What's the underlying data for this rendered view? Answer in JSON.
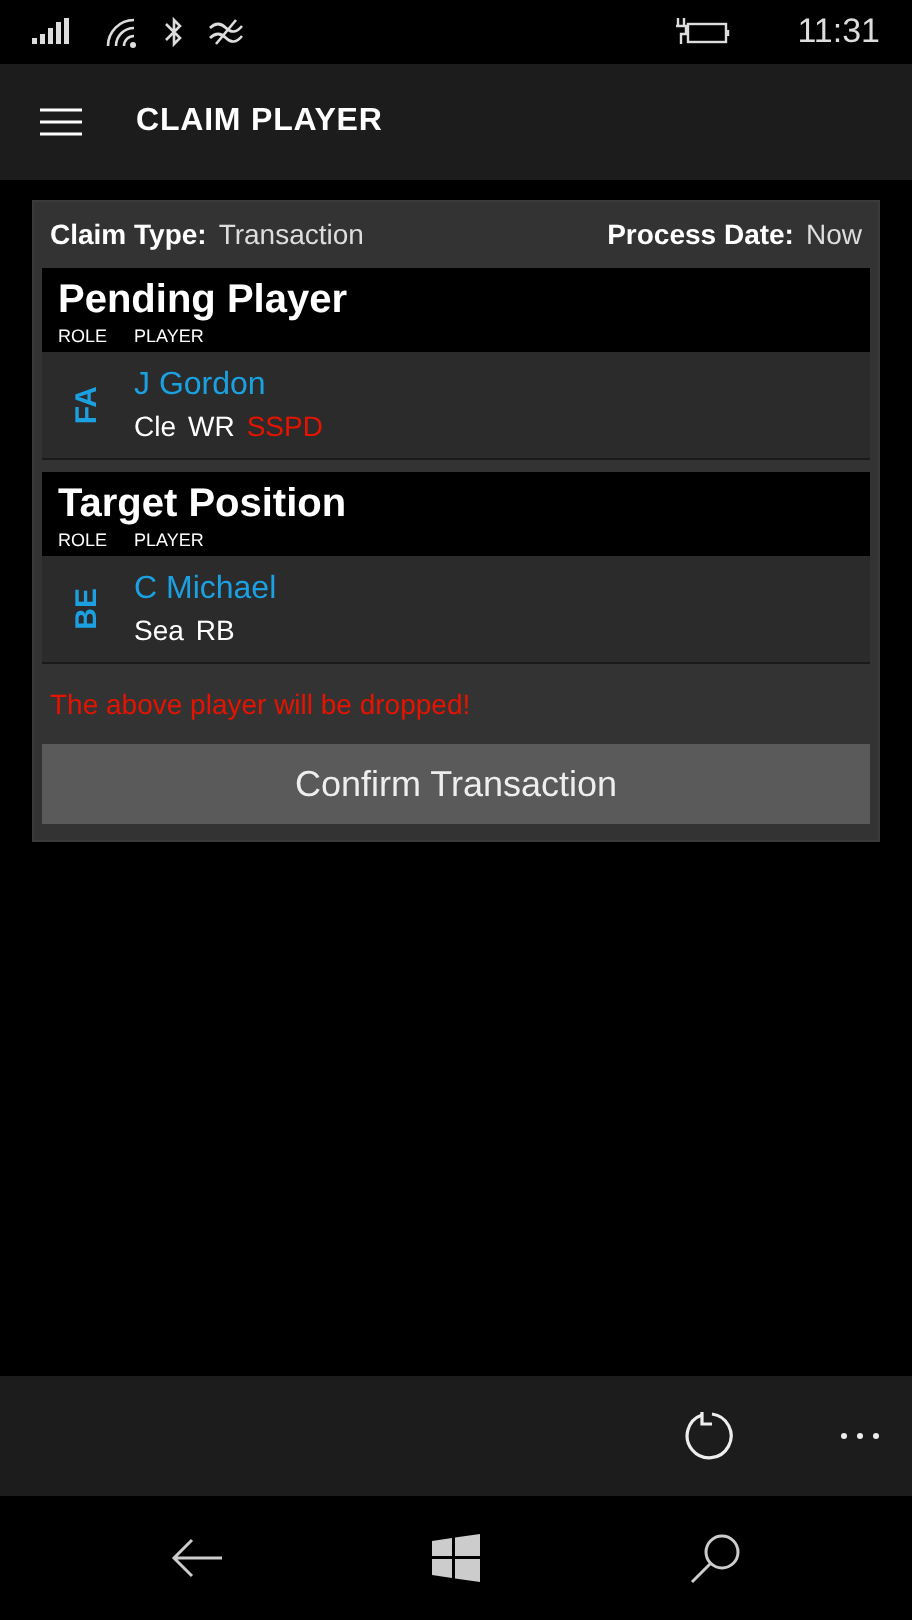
{
  "status_bar": {
    "time": "11:31"
  },
  "header": {
    "title": "CLAIM PLAYER"
  },
  "claim": {
    "type_label": "Claim Type:",
    "type_value": "Transaction",
    "date_label": "Process Date:",
    "date_value": "Now"
  },
  "sections": [
    {
      "title": "Pending Player",
      "columns": [
        "ROLE",
        "PLAYER"
      ],
      "player": {
        "role": "FA",
        "name": "J Gordon",
        "team": "Cle",
        "position": "WR",
        "status": "SSPD"
      }
    },
    {
      "title": "Target Position",
      "columns": [
        "ROLE",
        "PLAYER"
      ],
      "player": {
        "role": "BE",
        "name": "C Michael",
        "team": "Sea",
        "position": "RB"
      }
    }
  ],
  "warning": "The above player will be dropped!",
  "confirm_button": "Confirm Transaction"
}
